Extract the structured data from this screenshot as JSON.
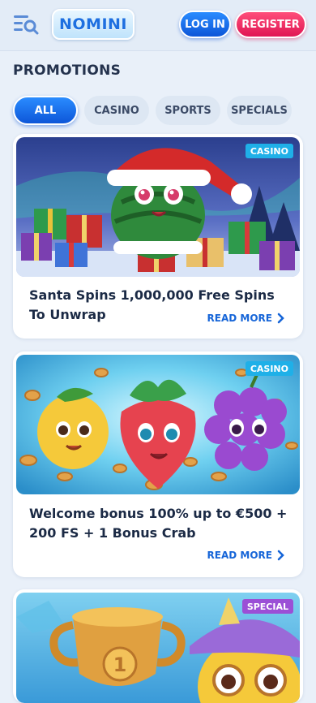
{
  "header": {
    "logo": "NOMINI",
    "login_label": "LOG IN",
    "register_label": "REGISTER"
  },
  "page": {
    "title": "PROMOTIONS"
  },
  "tabs": [
    {
      "label": "ALL",
      "active": true
    },
    {
      "label": "CASINO",
      "active": false
    },
    {
      "label": "SPORTS",
      "active": false
    },
    {
      "label": "SPECIALS",
      "active": false
    }
  ],
  "promotions": [
    {
      "badge": "CASINO",
      "title": "Santa Spins 1,000,000 Free Spins To Unwrap",
      "read_more": "READ MORE"
    },
    {
      "badge": "CASINO",
      "title": "Welcome bonus 100% up to €500 + 200 FS + 1 Bonus Crab",
      "read_more": "READ MORE"
    },
    {
      "badge": "SPECIAL"
    }
  ],
  "colors": {
    "brand_blue": "#0d56d8",
    "register_pink": "#e01654",
    "badge_casino": "#1fb0e8",
    "badge_special": "#9b4fd6"
  }
}
